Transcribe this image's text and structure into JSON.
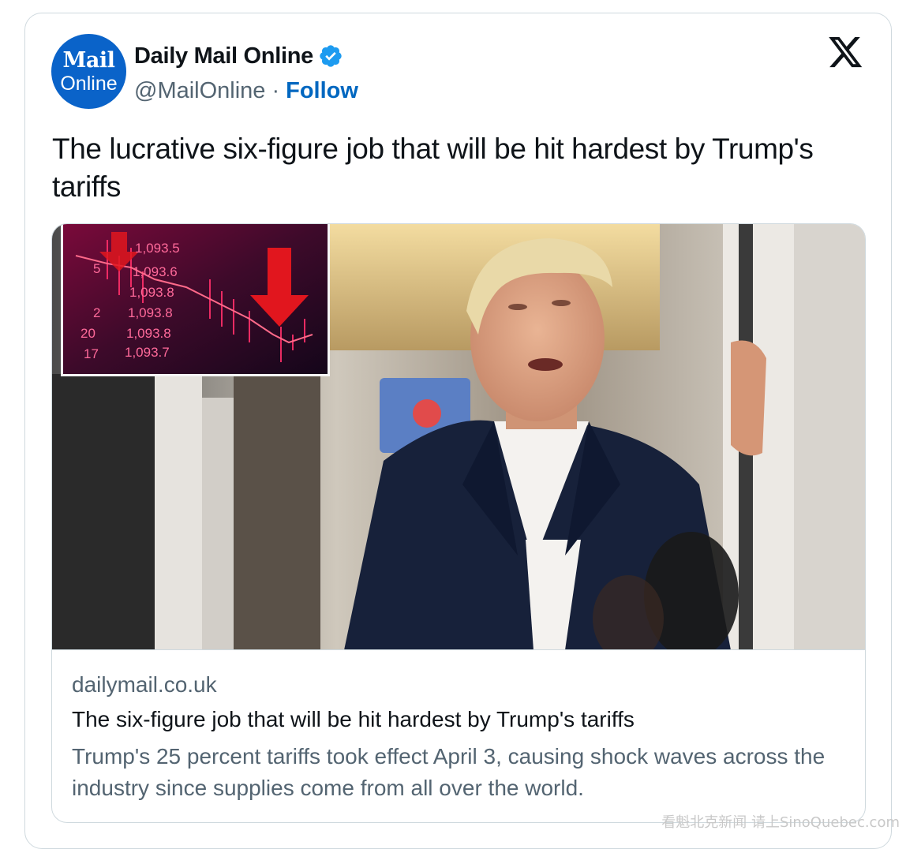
{
  "author": {
    "avatar_line1": "Mail",
    "avatar_line2": "Online",
    "name": "Daily Mail Online",
    "handle": "@MailOnline",
    "separator": "·",
    "follow_label": "Follow"
  },
  "tweet": {
    "text": "The lucrative six-figure job that will be hit hardest by Trump's tariffs"
  },
  "card": {
    "domain": "dailymail.co.uk",
    "title": "The six-figure job that will be hit hardest by Trump's tariffs",
    "description": "Trump's 25 percent tariffs took effect April 3, causing shock waves across the industry since supplies come from all over the world.",
    "inset_ticker_numbers": [
      "1,093.5",
      "1,093.6",
      "1,093.8",
      "1,093.8",
      "1,093.8",
      "1,093.7"
    ],
    "inset_side_numbers": [
      "5",
      "2",
      "20",
      "17"
    ]
  },
  "watermark": "看魁北克新闻 请上SinoQuebec.com",
  "colors": {
    "follow": "#0067c0",
    "verified": "#1d9bf0",
    "avatar_bg": "#0a63c9"
  },
  "icons": {
    "verified": "verified-badge-icon",
    "platform": "x-logo-icon"
  }
}
